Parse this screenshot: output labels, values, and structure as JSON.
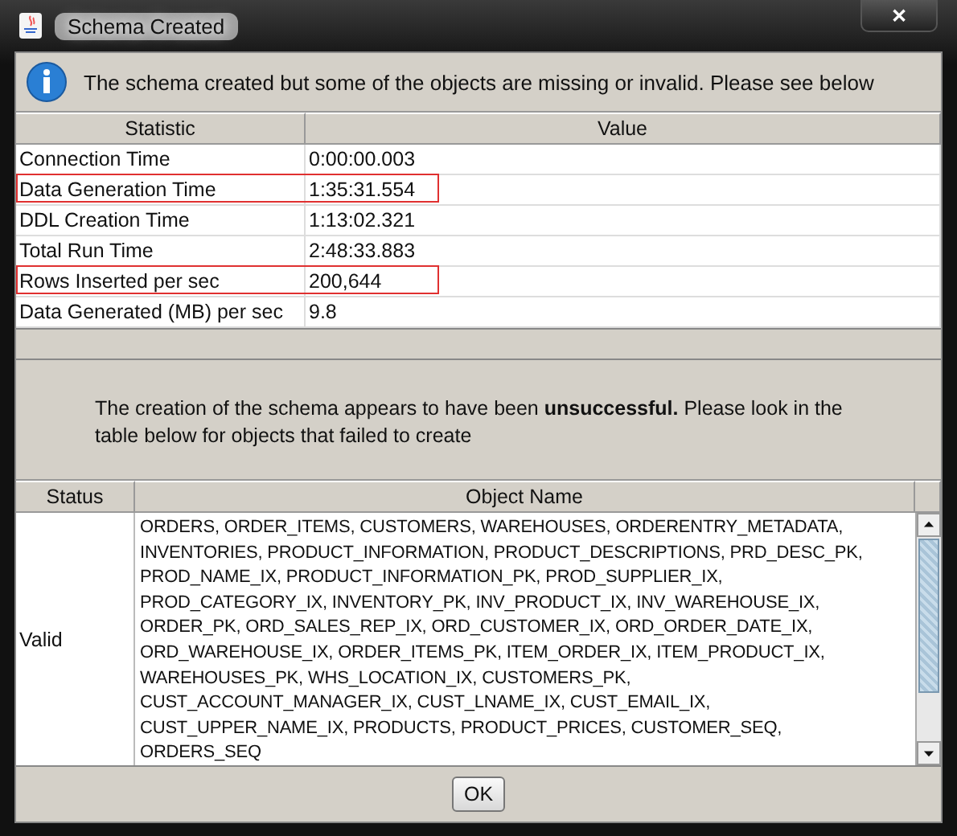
{
  "window": {
    "title": "Schema Created",
    "close": "✕"
  },
  "info_message": "The schema created but some of the objects are missing or invalid. Please see below",
  "stats_table": {
    "columns": [
      "Statistic",
      "Value"
    ],
    "rows": [
      {
        "statistic": "Connection Time",
        "value": "0:00:00.003",
        "highlighted": false
      },
      {
        "statistic": "Data Generation Time",
        "value": "1:35:31.554",
        "highlighted": true
      },
      {
        "statistic": "DDL Creation Time",
        "value": "1:13:02.321",
        "highlighted": false
      },
      {
        "statistic": "Total Run Time",
        "value": "2:48:33.883",
        "highlighted": false
      },
      {
        "statistic": "Rows Inserted per sec",
        "value": "200,644",
        "highlighted": true
      },
      {
        "statistic": "Data Generated (MB) per sec",
        "value": "9.8",
        "highlighted": false
      }
    ]
  },
  "result_message": "The creation of the schema appears to have been **unsuccessful.** Please look in the table below for objects that failed to create",
  "objects_table": {
    "columns": [
      "Status",
      "Object Name"
    ],
    "rows": [
      {
        "status": "Valid",
        "object_name_lines": [
          "ORDERS, ORDER_ITEMS, CUSTOMERS, WAREHOUSES, ORDERENTRY_METADATA,",
          "INVENTORIES, PRODUCT_INFORMATION, PRODUCT_DESCRIPTIONS, PRD_DESC_PK,",
          "PROD_NAME_IX, PRODUCT_INFORMATION_PK, PROD_SUPPLIER_IX,",
          "PROD_CATEGORY_IX, INVENTORY_PK, INV_PRODUCT_IX, INV_WAREHOUSE_IX,",
          "ORDER_PK, ORD_SALES_REP_IX, ORD_CUSTOMER_IX, ORD_ORDER_DATE_IX,",
          "ORD_WAREHOUSE_IX, ORDER_ITEMS_PK, ITEM_ORDER_IX, ITEM_PRODUCT_IX,",
          "WAREHOUSES_PK, WHS_LOCATION_IX, CUSTOMERS_PK,",
          "CUST_ACCOUNT_MANAGER_IX, CUST_LNAME_IX, CUST_EMAIL_IX,",
          "CUST_UPPER_NAME_IX, PRODUCTS, PRODUCT_PRICES, CUSTOMER_SEQ,",
          "ORDERS_SEQ"
        ]
      }
    ]
  },
  "buttons": [
    "OK"
  ]
}
